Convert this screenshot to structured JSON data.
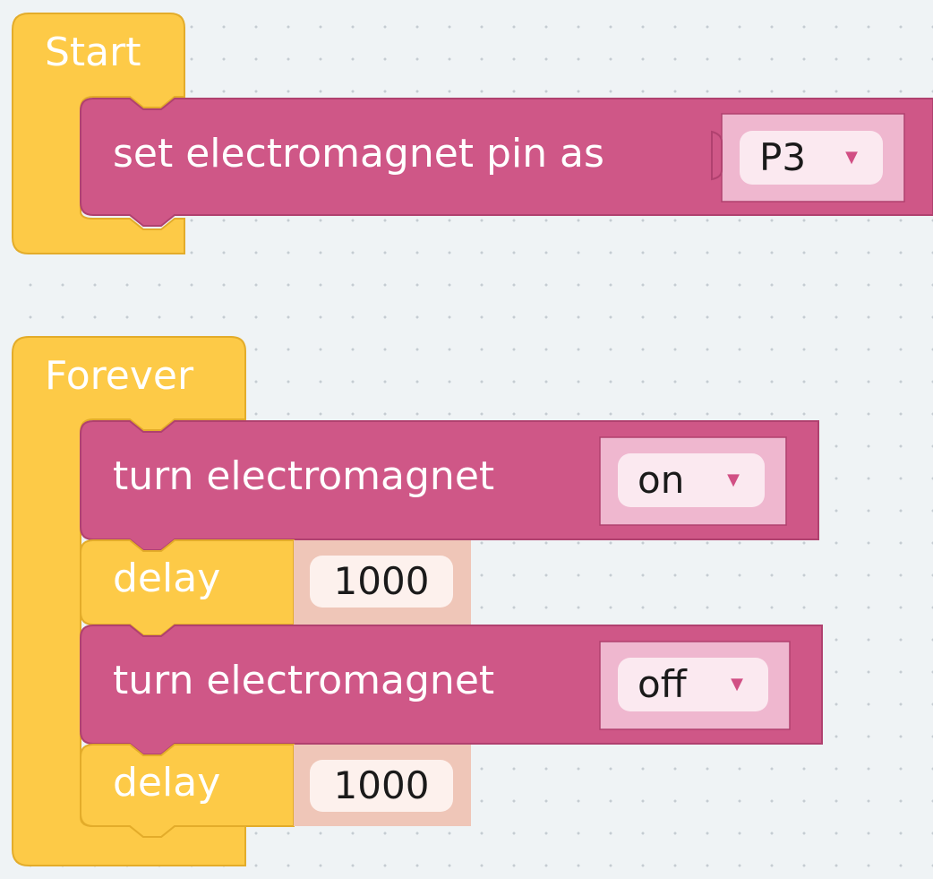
{
  "workspace": {
    "colors": {
      "event_block": "#fdca47",
      "event_block_dark": "#e3ac2a",
      "electromagnet_block": "#cf5787",
      "electromagnet_block_dark": "#b0416f",
      "dropdown_socket": "#efb7cf",
      "dropdown_field": "#fbe9f0",
      "delay_socket": "#efc6b8",
      "number_field": "#fdf1ed",
      "background": "#eff3f5"
    }
  },
  "start": {
    "label": "Start",
    "set_pin": {
      "label": "set electromagnet pin as",
      "value": "P3",
      "arrow": "▼"
    }
  },
  "forever": {
    "label": "Forever",
    "blocks": [
      {
        "type": "turn",
        "label": "turn electromagnet",
        "value": "on",
        "arrow": "▼"
      },
      {
        "type": "delay",
        "label": "delay",
        "value": "1000"
      },
      {
        "type": "turn",
        "label": "turn electromagnet",
        "value": "off",
        "arrow": "▼"
      },
      {
        "type": "delay",
        "label": "delay",
        "value": "1000"
      }
    ]
  }
}
